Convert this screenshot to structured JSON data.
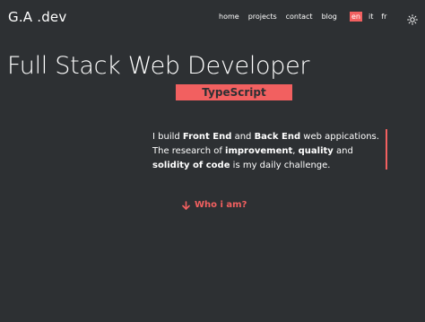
{
  "header": {
    "logo": "G.A .dev",
    "nav": [
      "home",
      "projects",
      "contact",
      "blog"
    ],
    "languages": [
      {
        "code": "en",
        "active": true
      },
      {
        "code": "it",
        "active": false
      },
      {
        "code": "fr",
        "active": false
      }
    ],
    "theme_icon": "sun-icon"
  },
  "hero": {
    "title": "Full Stack Web Developer",
    "typed_tech": "TypeScript",
    "intro": {
      "p1": "I build ",
      "b1": "Front End",
      "p2": " and ",
      "b2": "Back End",
      "p3": " web appications. The research of ",
      "b3": "improvement",
      "p4": ", ",
      "b4": "quality",
      "p5": " and ",
      "b5": "solidity of code",
      "p6": " is my daily challenge."
    },
    "cta": "Who i am?",
    "cta_icon": "arrow-down-icon"
  },
  "colors": {
    "background": "#2d3033",
    "accent": "#f26060",
    "text": "#ffffff"
  }
}
